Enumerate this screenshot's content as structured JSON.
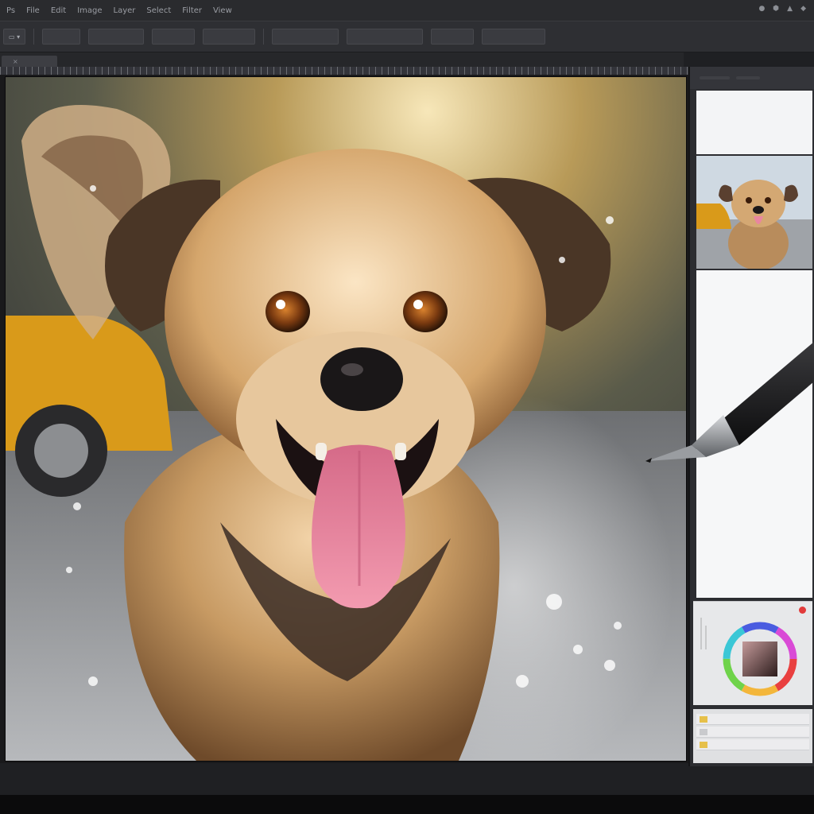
{
  "app": {
    "menu": [
      {
        "id": "ps-logo",
        "label": "Ps"
      },
      {
        "id": "file",
        "label": "File"
      },
      {
        "id": "edit",
        "label": "Edit"
      },
      {
        "id": "image",
        "label": "Image"
      },
      {
        "id": "layer",
        "label": "Layer"
      },
      {
        "id": "select",
        "label": "Select"
      },
      {
        "id": "filter",
        "label": "Filter"
      },
      {
        "id": "view",
        "label": "View"
      }
    ],
    "status": [
      "●",
      "⬢",
      "▲",
      "◆"
    ]
  },
  "options_bar": {
    "fields": [
      "▭ ▾",
      "",
      "",
      "",
      "",
      "",
      "",
      "",
      ""
    ]
  },
  "document": {
    "tab_label": "",
    "close_glyph": "×"
  },
  "panel": {
    "tabs": [
      "",
      ""
    ],
    "layers": [
      {
        "swatch": "#e6c04a"
      },
      {
        "swatch": "#c9cacd"
      },
      {
        "swatch": "#e6c04a"
      }
    ]
  },
  "colors": {
    "accent": "#e23b3b",
    "panel_bg": "#2c2d31",
    "workspace_bg": "#1f2023"
  },
  "icons": {
    "close": "close-icon",
    "stylus": "stylus-icon",
    "color-wheel": "color-wheel-icon"
  }
}
